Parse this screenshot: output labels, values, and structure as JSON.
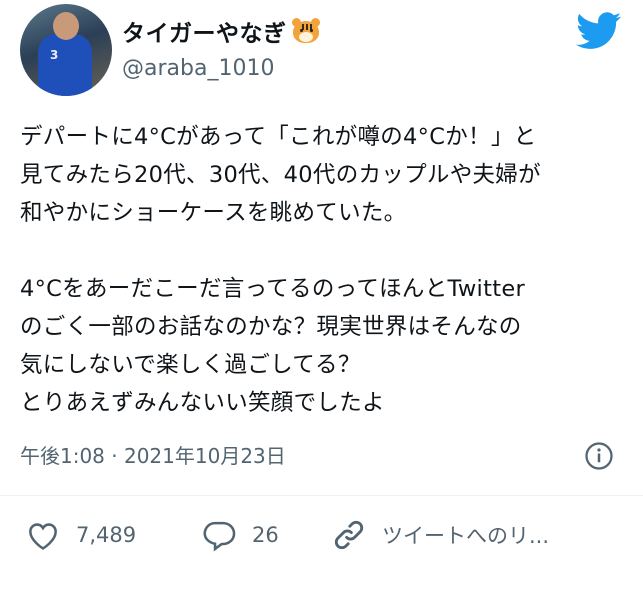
{
  "author": {
    "display_name": "タイガーやなぎ",
    "name_emoji": "tiger-face-emoji",
    "handle": "@araba_1010",
    "avatar_number": "3"
  },
  "tweet": {
    "lines_paragraph1": [
      "デパートに4°Cがあって「これが噂の4°Cか！」と",
      "見てみたら20代、30代、40代のカップルや夫婦が",
      "和やかにショーケースを眺めていた。"
    ],
    "lines_paragraph2": [
      "4°Cをあーだこーだ言ってるのってほんとTwitter",
      "のごく一部のお話なのかな？現実世界はそんなの",
      "気にしないで楽しく過ごしてる？",
      "とりあえずみんないい笑顔でしたよ"
    ],
    "timestamp": "午後1:08 · 2021年10月23日"
  },
  "actions": {
    "like_count": "7,489",
    "reply_count": "26",
    "share_label": "ツイートへのリ..."
  },
  "colors": {
    "twitter_blue": "#1d9bf0",
    "secondary_text": "#536471",
    "primary_text": "#0f1419"
  }
}
